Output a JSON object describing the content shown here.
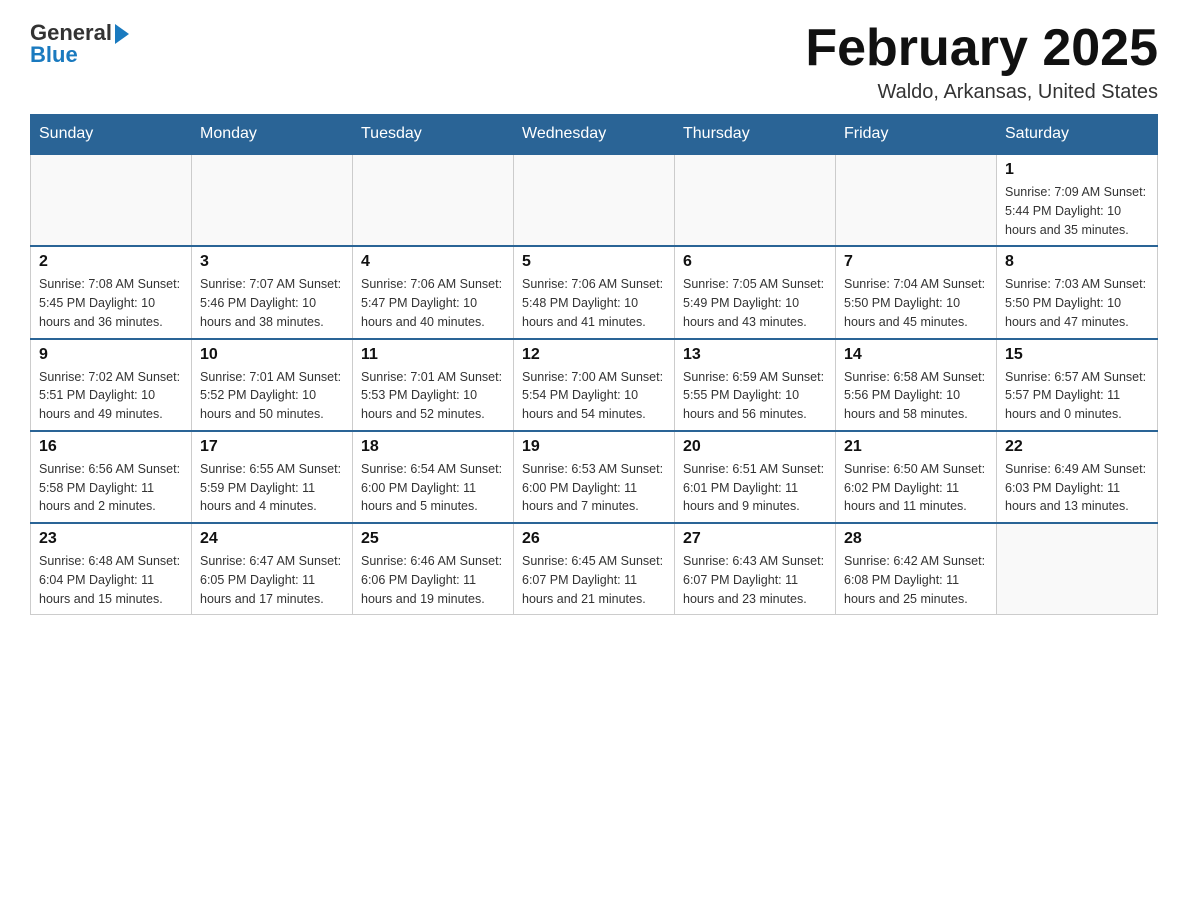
{
  "logo": {
    "general": "General",
    "blue": "Blue"
  },
  "header": {
    "month_year": "February 2025",
    "location": "Waldo, Arkansas, United States"
  },
  "days_of_week": [
    "Sunday",
    "Monday",
    "Tuesday",
    "Wednesday",
    "Thursday",
    "Friday",
    "Saturday"
  ],
  "weeks": [
    [
      {
        "day": "",
        "info": ""
      },
      {
        "day": "",
        "info": ""
      },
      {
        "day": "",
        "info": ""
      },
      {
        "day": "",
        "info": ""
      },
      {
        "day": "",
        "info": ""
      },
      {
        "day": "",
        "info": ""
      },
      {
        "day": "1",
        "info": "Sunrise: 7:09 AM\nSunset: 5:44 PM\nDaylight: 10 hours and 35 minutes."
      }
    ],
    [
      {
        "day": "2",
        "info": "Sunrise: 7:08 AM\nSunset: 5:45 PM\nDaylight: 10 hours and 36 minutes."
      },
      {
        "day": "3",
        "info": "Sunrise: 7:07 AM\nSunset: 5:46 PM\nDaylight: 10 hours and 38 minutes."
      },
      {
        "day": "4",
        "info": "Sunrise: 7:06 AM\nSunset: 5:47 PM\nDaylight: 10 hours and 40 minutes."
      },
      {
        "day": "5",
        "info": "Sunrise: 7:06 AM\nSunset: 5:48 PM\nDaylight: 10 hours and 41 minutes."
      },
      {
        "day": "6",
        "info": "Sunrise: 7:05 AM\nSunset: 5:49 PM\nDaylight: 10 hours and 43 minutes."
      },
      {
        "day": "7",
        "info": "Sunrise: 7:04 AM\nSunset: 5:50 PM\nDaylight: 10 hours and 45 minutes."
      },
      {
        "day": "8",
        "info": "Sunrise: 7:03 AM\nSunset: 5:50 PM\nDaylight: 10 hours and 47 minutes."
      }
    ],
    [
      {
        "day": "9",
        "info": "Sunrise: 7:02 AM\nSunset: 5:51 PM\nDaylight: 10 hours and 49 minutes."
      },
      {
        "day": "10",
        "info": "Sunrise: 7:01 AM\nSunset: 5:52 PM\nDaylight: 10 hours and 50 minutes."
      },
      {
        "day": "11",
        "info": "Sunrise: 7:01 AM\nSunset: 5:53 PM\nDaylight: 10 hours and 52 minutes."
      },
      {
        "day": "12",
        "info": "Sunrise: 7:00 AM\nSunset: 5:54 PM\nDaylight: 10 hours and 54 minutes."
      },
      {
        "day": "13",
        "info": "Sunrise: 6:59 AM\nSunset: 5:55 PM\nDaylight: 10 hours and 56 minutes."
      },
      {
        "day": "14",
        "info": "Sunrise: 6:58 AM\nSunset: 5:56 PM\nDaylight: 10 hours and 58 minutes."
      },
      {
        "day": "15",
        "info": "Sunrise: 6:57 AM\nSunset: 5:57 PM\nDaylight: 11 hours and 0 minutes."
      }
    ],
    [
      {
        "day": "16",
        "info": "Sunrise: 6:56 AM\nSunset: 5:58 PM\nDaylight: 11 hours and 2 minutes."
      },
      {
        "day": "17",
        "info": "Sunrise: 6:55 AM\nSunset: 5:59 PM\nDaylight: 11 hours and 4 minutes."
      },
      {
        "day": "18",
        "info": "Sunrise: 6:54 AM\nSunset: 6:00 PM\nDaylight: 11 hours and 5 minutes."
      },
      {
        "day": "19",
        "info": "Sunrise: 6:53 AM\nSunset: 6:00 PM\nDaylight: 11 hours and 7 minutes."
      },
      {
        "day": "20",
        "info": "Sunrise: 6:51 AM\nSunset: 6:01 PM\nDaylight: 11 hours and 9 minutes."
      },
      {
        "day": "21",
        "info": "Sunrise: 6:50 AM\nSunset: 6:02 PM\nDaylight: 11 hours and 11 minutes."
      },
      {
        "day": "22",
        "info": "Sunrise: 6:49 AM\nSunset: 6:03 PM\nDaylight: 11 hours and 13 minutes."
      }
    ],
    [
      {
        "day": "23",
        "info": "Sunrise: 6:48 AM\nSunset: 6:04 PM\nDaylight: 11 hours and 15 minutes."
      },
      {
        "day": "24",
        "info": "Sunrise: 6:47 AM\nSunset: 6:05 PM\nDaylight: 11 hours and 17 minutes."
      },
      {
        "day": "25",
        "info": "Sunrise: 6:46 AM\nSunset: 6:06 PM\nDaylight: 11 hours and 19 minutes."
      },
      {
        "day": "26",
        "info": "Sunrise: 6:45 AM\nSunset: 6:07 PM\nDaylight: 11 hours and 21 minutes."
      },
      {
        "day": "27",
        "info": "Sunrise: 6:43 AM\nSunset: 6:07 PM\nDaylight: 11 hours and 23 minutes."
      },
      {
        "day": "28",
        "info": "Sunrise: 6:42 AM\nSunset: 6:08 PM\nDaylight: 11 hours and 25 minutes."
      },
      {
        "day": "",
        "info": ""
      }
    ]
  ]
}
